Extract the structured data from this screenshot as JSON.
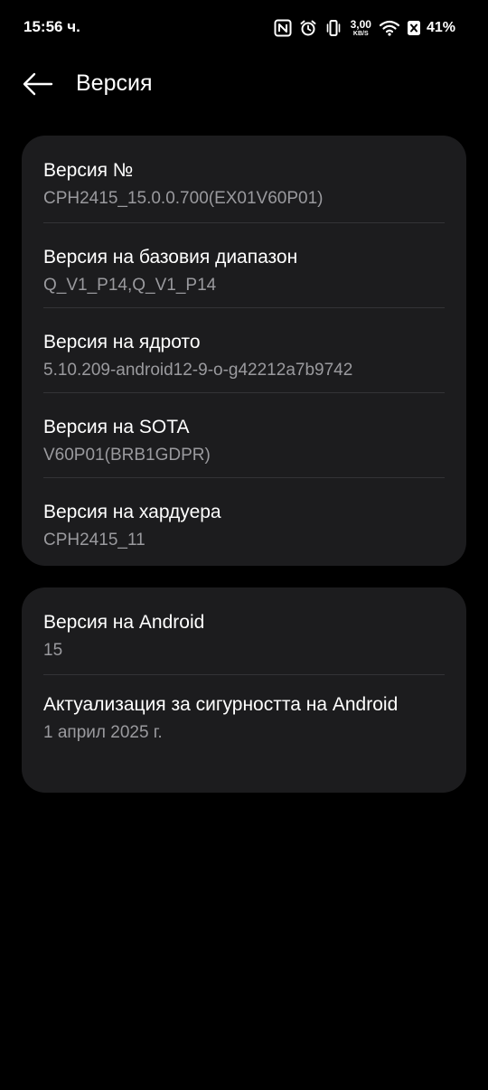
{
  "status_bar": {
    "time": "15:56 ч.",
    "net_speed_value": "3,00",
    "net_speed_unit": "KB/S",
    "battery_percent": "41%"
  },
  "header": {
    "title": "Версия"
  },
  "cards": [
    {
      "items": [
        {
          "title": "Версия №",
          "value": "CPH2415_15.0.0.700(EX01V60P01)"
        },
        {
          "title": "Версия на базовия диапазон",
          "value": "Q_V1_P14,Q_V1_P14"
        },
        {
          "title": "Версия на ядрото",
          "value": "5.10.209-android12-9-o-g42212a7b9742"
        },
        {
          "title": "Версия на SOTA",
          "value": "V60P01(BRB1GDPR)"
        },
        {
          "title": "Версия на хардуера",
          "value": "CPH2415_11"
        }
      ]
    },
    {
      "items": [
        {
          "title": "Версия на Android",
          "value": "15"
        },
        {
          "title": "Актуализация за сигурността на Android",
          "value": "1 април 2025 г."
        }
      ]
    }
  ],
  "colors": {
    "background": "#000000",
    "card_background": "#1c1c1e",
    "primary_text": "#ffffff",
    "secondary_text": "#9a9a9e",
    "divider": "#333336"
  },
  "icons": [
    "nfc-icon",
    "alarm-icon",
    "vibrate-icon",
    "wifi-icon",
    "battery-icon",
    "back-arrow-icon"
  ]
}
